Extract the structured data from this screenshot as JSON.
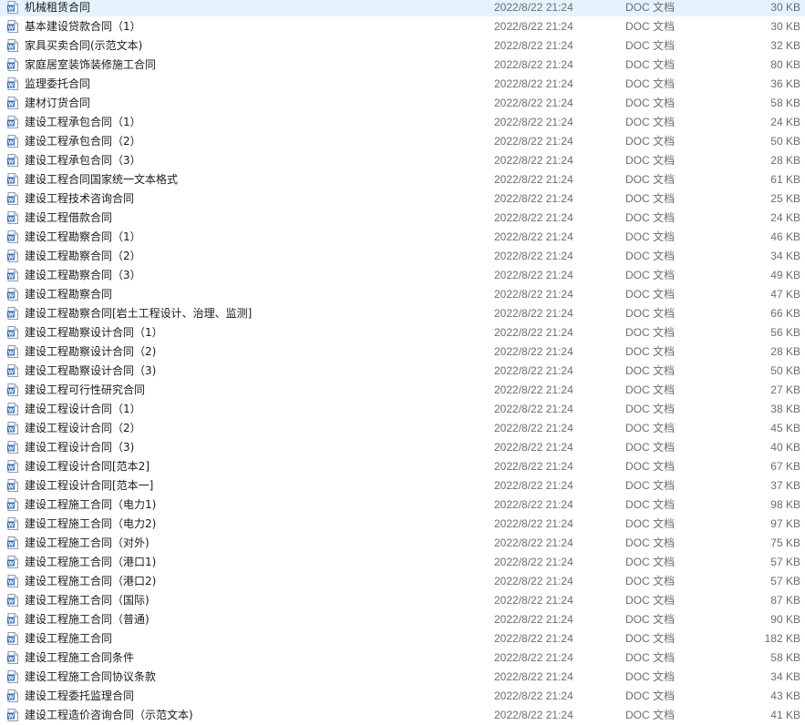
{
  "colors": {
    "doc_icon_blue": "#2b6cc4",
    "text_primary": "#1a1a1a",
    "text_secondary": "#6d6d6d",
    "background": "#ffffff"
  },
  "icon": "word-doc-icon",
  "files": [
    {
      "name": "机械租赁合同",
      "date": "2022/8/22 21:24",
      "type": "DOC 文档",
      "size": "30 KB"
    },
    {
      "name": "基本建设贷款合同（1）",
      "date": "2022/8/22 21:24",
      "type": "DOC 文档",
      "size": "30 KB"
    },
    {
      "name": "家具买卖合同(示范文本)",
      "date": "2022/8/22 21:24",
      "type": "DOC 文档",
      "size": "32 KB"
    },
    {
      "name": "家庭居室装饰装修施工合同",
      "date": "2022/8/22 21:24",
      "type": "DOC 文档",
      "size": "80 KB"
    },
    {
      "name": "监理委托合同",
      "date": "2022/8/22 21:24",
      "type": "DOC 文档",
      "size": "36 KB"
    },
    {
      "name": "建材订货合同",
      "date": "2022/8/22 21:24",
      "type": "DOC 文档",
      "size": "58 KB"
    },
    {
      "name": "建设工程承包合同（1）",
      "date": "2022/8/22 21:24",
      "type": "DOC 文档",
      "size": "24 KB"
    },
    {
      "name": "建设工程承包合同（2）",
      "date": "2022/8/22 21:24",
      "type": "DOC 文档",
      "size": "50 KB"
    },
    {
      "name": "建设工程承包合同（3）",
      "date": "2022/8/22 21:24",
      "type": "DOC 文档",
      "size": "28 KB"
    },
    {
      "name": "建设工程合同国家统一文本格式",
      "date": "2022/8/22 21:24",
      "type": "DOC 文档",
      "size": "61 KB"
    },
    {
      "name": "建设工程技术咨询合同",
      "date": "2022/8/22 21:24",
      "type": "DOC 文档",
      "size": "25 KB"
    },
    {
      "name": "建设工程借款合同",
      "date": "2022/8/22 21:24",
      "type": "DOC 文档",
      "size": "24 KB"
    },
    {
      "name": "建设工程勘察合同（1）",
      "date": "2022/8/22 21:24",
      "type": "DOC 文档",
      "size": "46 KB"
    },
    {
      "name": "建设工程勘察合同（2）",
      "date": "2022/8/22 21:24",
      "type": "DOC 文档",
      "size": "34 KB"
    },
    {
      "name": "建设工程勘察合同（3）",
      "date": "2022/8/22 21:24",
      "type": "DOC 文档",
      "size": "49 KB"
    },
    {
      "name": "建设工程勘察合同",
      "date": "2022/8/22 21:24",
      "type": "DOC 文档",
      "size": "47 KB"
    },
    {
      "name": "建设工程勘察合同[岩土工程设计、治理、监测]",
      "date": "2022/8/22 21:24",
      "type": "DOC 文档",
      "size": "66 KB"
    },
    {
      "name": "建设工程勘察设计合同（1）",
      "date": "2022/8/22 21:24",
      "type": "DOC 文档",
      "size": "56 KB"
    },
    {
      "name": "建设工程勘察设计合同（2)",
      "date": "2022/8/22 21:24",
      "type": "DOC 文档",
      "size": "28 KB"
    },
    {
      "name": "建设工程勘察设计合同（3)",
      "date": "2022/8/22 21:24",
      "type": "DOC 文档",
      "size": "50 KB"
    },
    {
      "name": "建设工程可行性研究合同",
      "date": "2022/8/22 21:24",
      "type": "DOC 文档",
      "size": "27 KB"
    },
    {
      "name": "建设工程设计合同（1）",
      "date": "2022/8/22 21:24",
      "type": "DOC 文档",
      "size": "38 KB"
    },
    {
      "name": "建设工程设计合同（2）",
      "date": "2022/8/22 21:24",
      "type": "DOC 文档",
      "size": "45 KB"
    },
    {
      "name": "建设工程设计合同（3)",
      "date": "2022/8/22 21:24",
      "type": "DOC 文档",
      "size": "40 KB"
    },
    {
      "name": "建设工程设计合同[范本2]",
      "date": "2022/8/22 21:24",
      "type": "DOC 文档",
      "size": "67 KB"
    },
    {
      "name": "建设工程设计合同[范本一]",
      "date": "2022/8/22 21:24",
      "type": "DOC 文档",
      "size": "37 KB"
    },
    {
      "name": "建设工程施工合同（电力1)",
      "date": "2022/8/22 21:24",
      "type": "DOC 文档",
      "size": "98 KB"
    },
    {
      "name": "建设工程施工合同（电力2)",
      "date": "2022/8/22 21:24",
      "type": "DOC 文档",
      "size": "97 KB"
    },
    {
      "name": "建设工程施工合同（对外)",
      "date": "2022/8/22 21:24",
      "type": "DOC 文档",
      "size": "75 KB"
    },
    {
      "name": "建设工程施工合同（港口1)",
      "date": "2022/8/22 21:24",
      "type": "DOC 文档",
      "size": "57 KB"
    },
    {
      "name": "建设工程施工合同（港口2)",
      "date": "2022/8/22 21:24",
      "type": "DOC 文档",
      "size": "57 KB"
    },
    {
      "name": "建设工程施工合同（国际)",
      "date": "2022/8/22 21:24",
      "type": "DOC 文档",
      "size": "87 KB"
    },
    {
      "name": "建设工程施工合同（普通)",
      "date": "2022/8/22 21:24",
      "type": "DOC 文档",
      "size": "90 KB"
    },
    {
      "name": "建设工程施工合同",
      "date": "2022/8/22 21:24",
      "type": "DOC 文档",
      "size": "182 KB"
    },
    {
      "name": "建设工程施工合同条件",
      "date": "2022/8/22 21:24",
      "type": "DOC 文档",
      "size": "58 KB"
    },
    {
      "name": "建设工程施工合同协议条款",
      "date": "2022/8/22 21:24",
      "type": "DOC 文档",
      "size": "34 KB"
    },
    {
      "name": "建设工程委托监理合同",
      "date": "2022/8/22 21:24",
      "type": "DOC 文档",
      "size": "43 KB"
    },
    {
      "name": "建设工程造价咨询合同（示范文本)",
      "date": "2022/8/22 21:24",
      "type": "DOC 文档",
      "size": "41 KB"
    }
  ]
}
